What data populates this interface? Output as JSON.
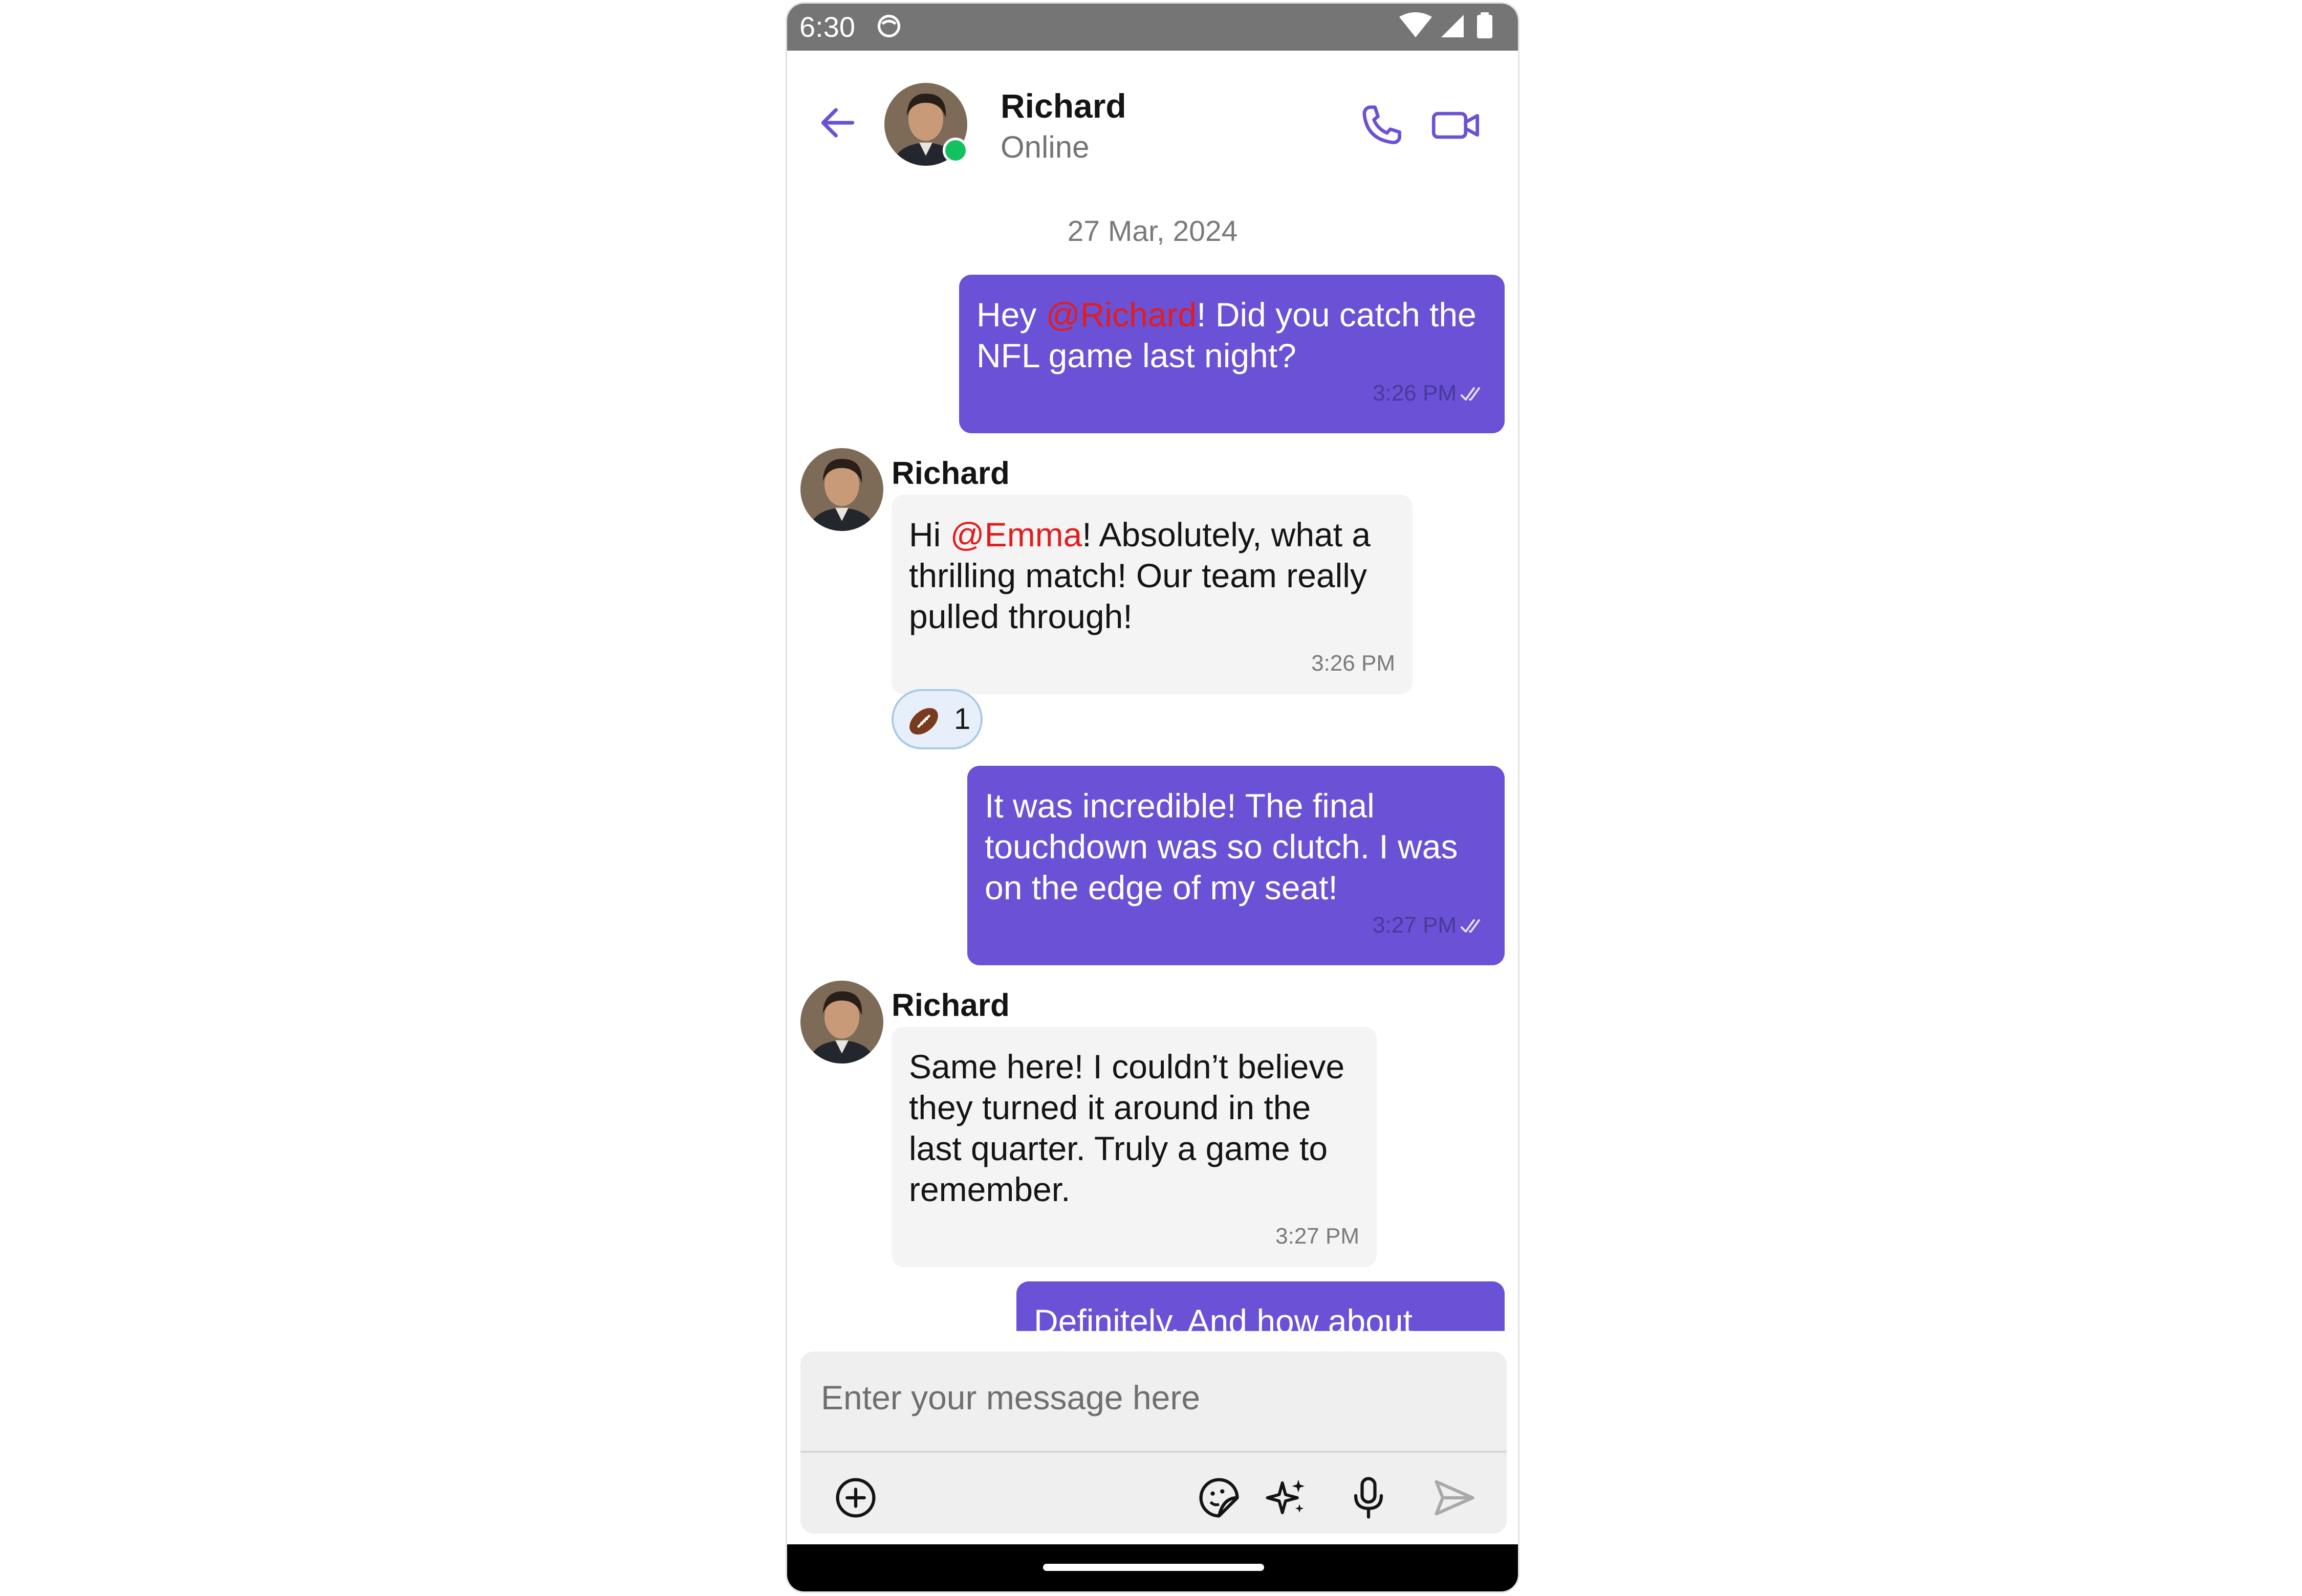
{
  "status_bar": {
    "time": "6:30"
  },
  "header": {
    "contact_name": "Richard",
    "presence": "Online"
  },
  "chat": {
    "date_separator": "27 Mar, 2024",
    "messages": [
      {
        "direction": "outgoing",
        "text_before": "Hey ",
        "mention": "@Richard",
        "text_after": "! Did you catch the NFL game last night?",
        "time": "3:26 PM"
      },
      {
        "direction": "incoming",
        "sender": "Richard",
        "text_before": "Hi ",
        "mention": "@Emma",
        "text_after": "! Absolutely, what a thrilling match! Our team really pulled through!",
        "time": "3:26 PM",
        "reaction": {
          "emoji": "american-football",
          "count": "1"
        }
      },
      {
        "direction": "outgoing",
        "text": "It was incredible! The final touchdown was so clutch. I was on the edge of my seat!",
        "time": "3:27 PM"
      },
      {
        "direction": "incoming",
        "sender": "Richard",
        "text": "Same here! I couldn’t believe they turned it around in the last quarter. Truly a game to remember.",
        "time": "3:27 PM"
      },
      {
        "direction": "outgoing",
        "text": "Definitely. And how about"
      }
    ]
  },
  "composer": {
    "placeholder": "Enter your message here"
  },
  "icons": {
    "back": "arrow-left-icon",
    "call": "phone-icon",
    "video": "video-camera-icon",
    "attach": "plus-circle-icon",
    "sticker": "sticker-icon",
    "ai": "sparkles-icon",
    "mic": "microphone-icon",
    "send": "send-icon"
  },
  "colors": {
    "accent": "#6a51d5",
    "mention": "#e21d1d",
    "online": "#12c15f",
    "incoming_bubble": "#f4f4f4"
  }
}
